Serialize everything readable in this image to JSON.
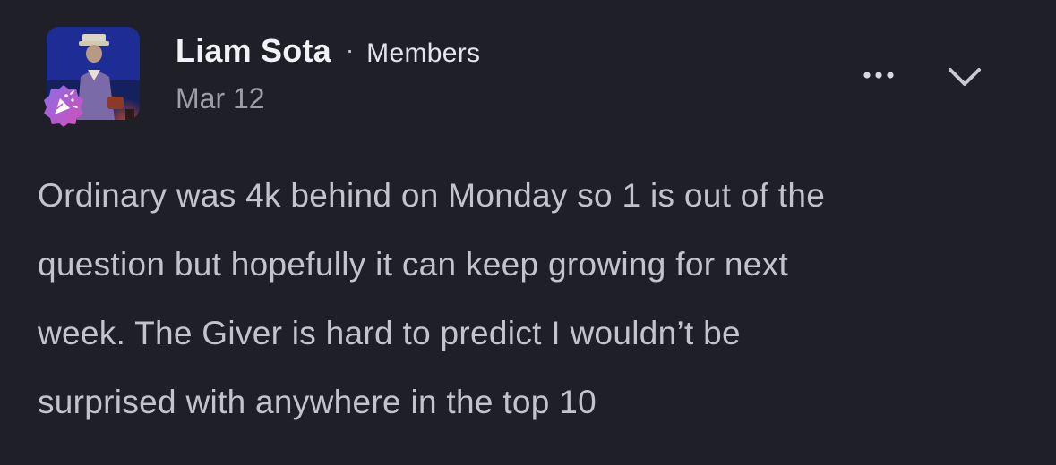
{
  "post": {
    "author": "Liam Sota",
    "separator": "·",
    "role": "Members",
    "date": "Mar 12",
    "body_lines": [
      "Ordinary was 4k behind on Monday so 1 is out of the",
      "question but hopefully it can keep growing for next",
      "week. The Giver is hard to predict I wouldn’t be",
      "surprised with anywhere in the top 10"
    ]
  },
  "icons": {
    "badge": "party-popper-icon",
    "more": "more-horizontal-icon",
    "expand": "chevron-down-icon"
  },
  "colors": {
    "background": "#1f2027",
    "author": "#f2f2f6",
    "date": "#9d9ea7",
    "body": "#c3c3cb",
    "badge": "#b25bd6"
  }
}
